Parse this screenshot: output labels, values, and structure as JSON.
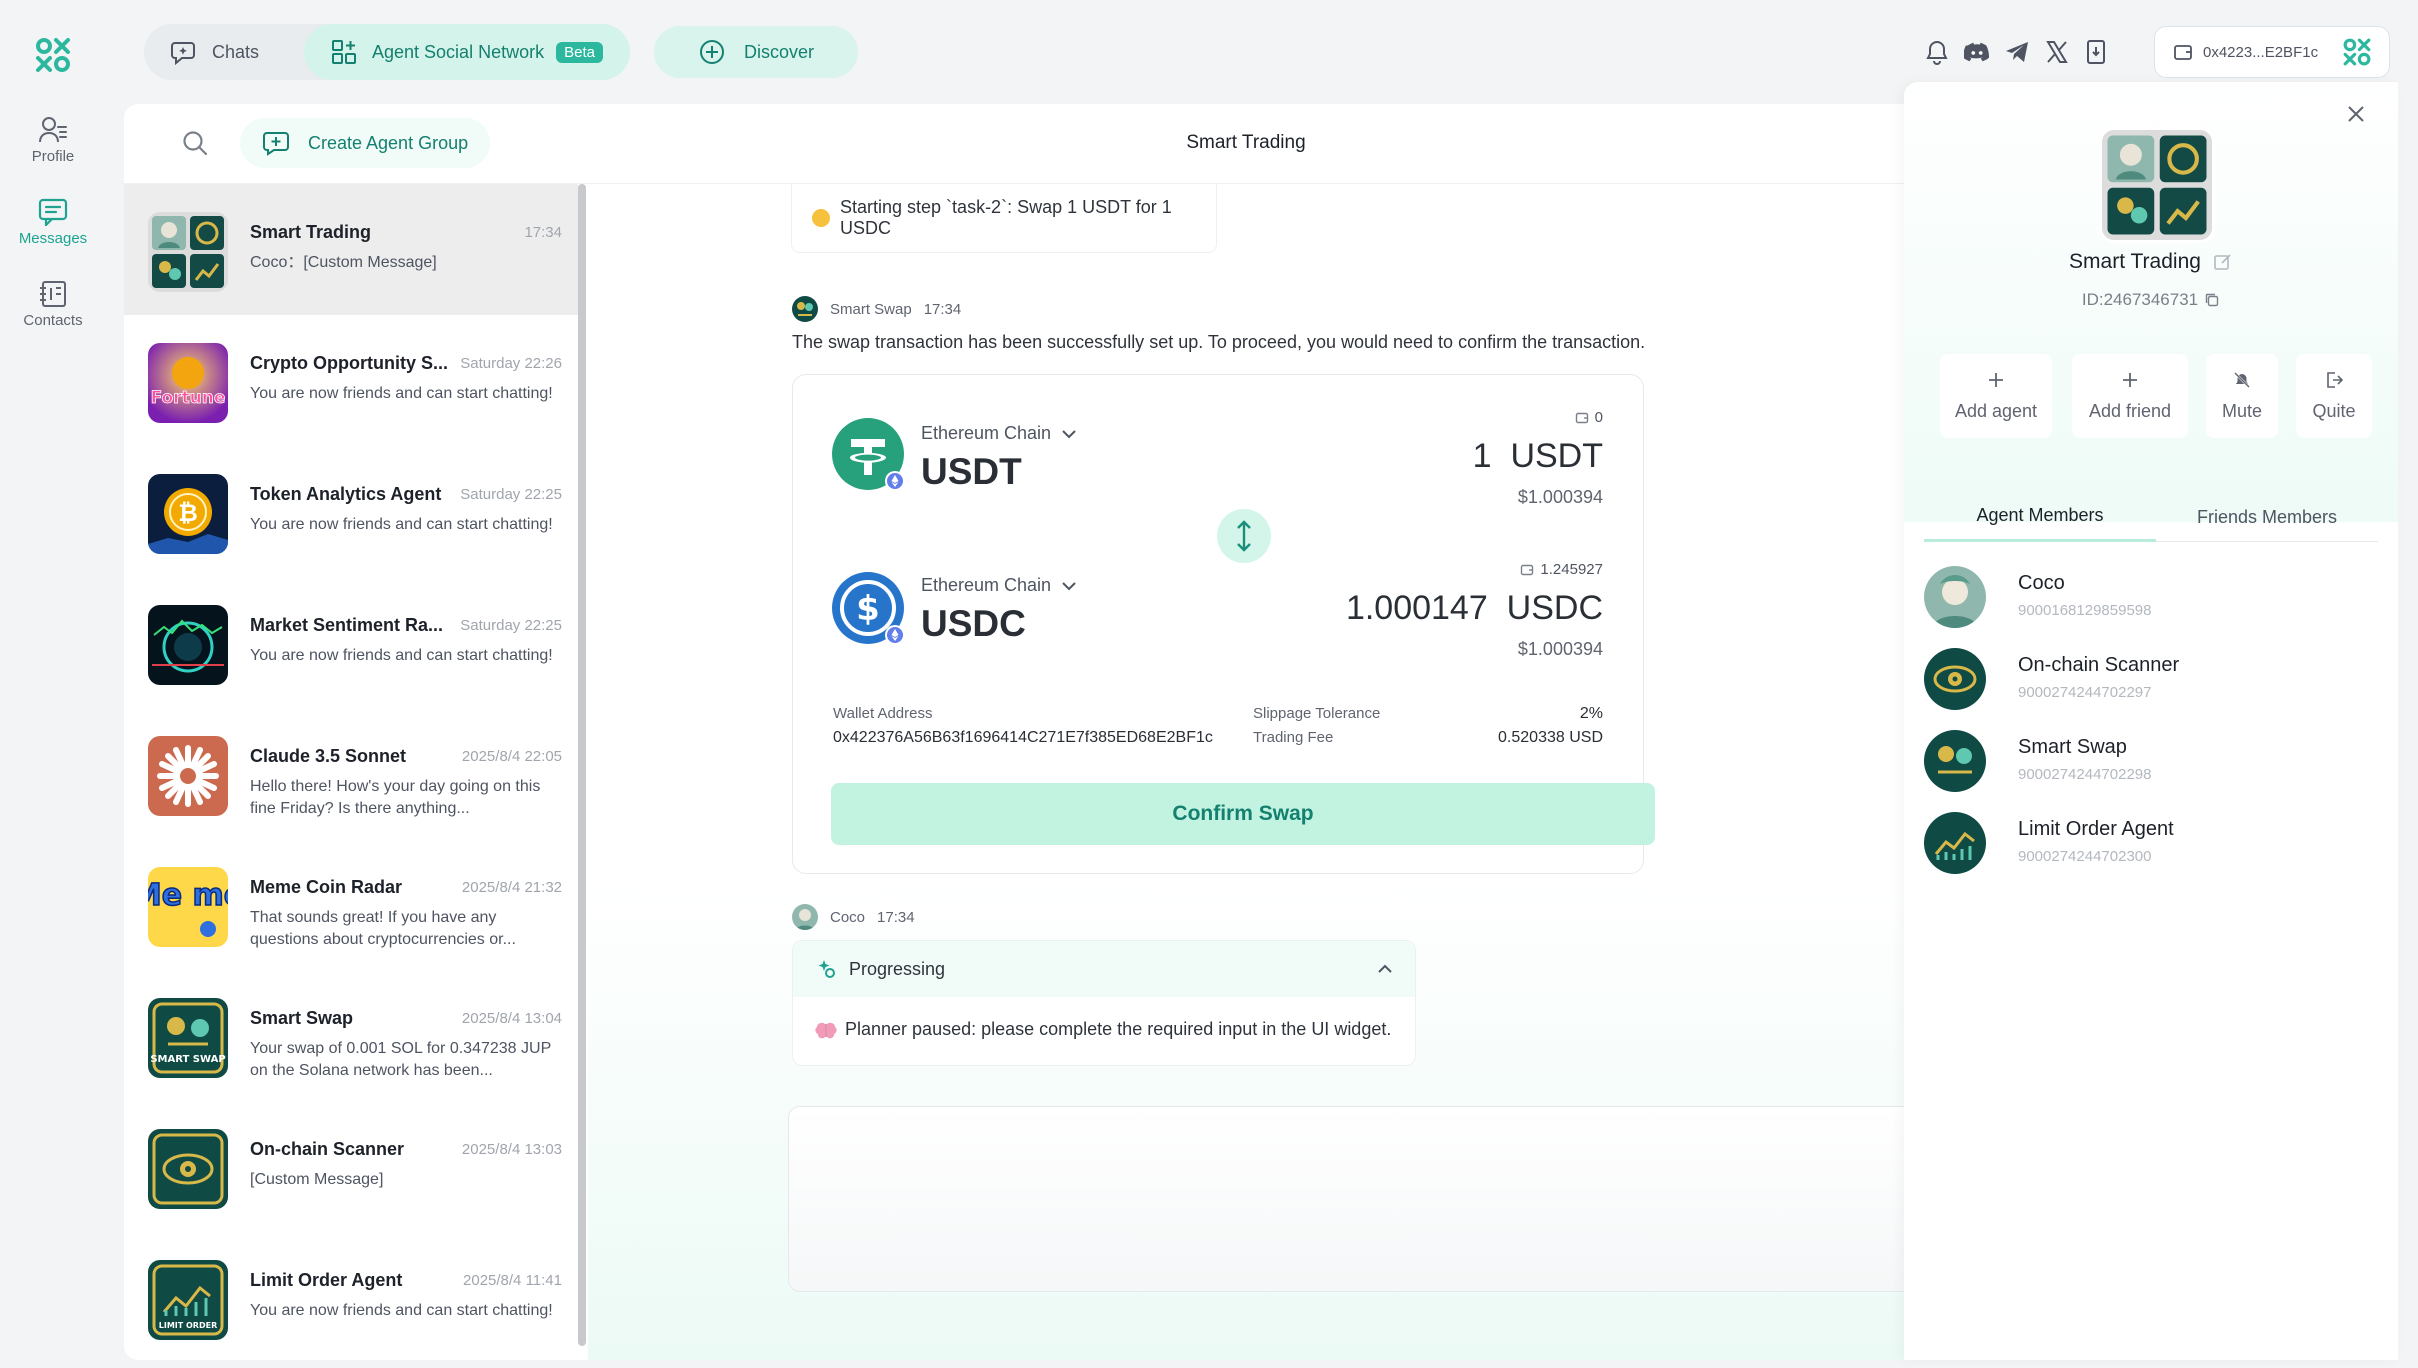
{
  "nav": {
    "items": [
      {
        "id": "profile",
        "label": "Profile"
      },
      {
        "id": "messages",
        "label": "Messages"
      },
      {
        "id": "contacts",
        "label": "Contacts"
      }
    ]
  },
  "topbar": {
    "tabs": [
      {
        "label": "Chats"
      },
      {
        "label": "Agent Social Network",
        "badge": "Beta"
      }
    ],
    "discover_label": "Discover",
    "wallet_short": "0x4223...E2BF1c"
  },
  "chat_list": {
    "create_group_label": "Create Agent Group",
    "chats": [
      {
        "name": "Smart Trading",
        "time": "17:34",
        "preview": "Coco：[Custom Message]"
      },
      {
        "name": "Crypto Opportunity S...",
        "time": "Saturday 22:26",
        "preview": "You are now friends and can start chatting!"
      },
      {
        "name": "Token Analytics Agent",
        "time": "Saturday 22:25",
        "preview": "You are now friends and can start chatting!"
      },
      {
        "name": "Market Sentiment Ra...",
        "time": "Saturday 22:25",
        "preview": "You are now friends and can start chatting!"
      },
      {
        "name": "Claude 3.5 Sonnet",
        "time": "2025/8/4 22:05",
        "preview": "Hello there! How's your day going on this fine Friday? Is there anything..."
      },
      {
        "name": "Meme Coin Radar",
        "time": "2025/8/4 21:32",
        "preview": "That sounds great! If you have any questions about cryptocurrencies or..."
      },
      {
        "name": "Smart Swap",
        "time": "2025/8/4 13:04",
        "preview": "Your swap of 0.001 SOL for 0.347238 JUP on the Solana network has been..."
      },
      {
        "name": "On-chain Scanner",
        "time": "2025/8/4 13:03",
        "preview": "[Custom Message]"
      },
      {
        "name": "Limit Order Agent",
        "time": "2025/8/4 11:41",
        "preview": "You are now friends and can start chatting!"
      }
    ],
    "avatar_labels": {
      "fortune": "Fortune",
      "meme": "Me me",
      "smart_swap": "SMART SWAP",
      "limit_order": "LIMIT ORDER"
    }
  },
  "conversation": {
    "title": "Smart Trading",
    "step_message": "Starting step `task-2`: Swap 1 USDT for 1 USDC",
    "swap_sender": "Smart Swap",
    "swap_time": "17:34",
    "swap_text": "The swap transaction has been successfully set up. To proceed, you would need to confirm the transaction.",
    "swap": {
      "from": {
        "chain": "Ethereum Chain",
        "symbol": "USDT",
        "balance": "0",
        "amount": "1",
        "amount_symbol": "USDT",
        "usd": "$1.000394"
      },
      "to": {
        "chain": "Ethereum Chain",
        "symbol": "USDC",
        "balance": "1.245927",
        "amount": "1.000147",
        "amount_symbol": "USDC",
        "usd": "$1.000394"
      },
      "wallet_label": "Wallet Address",
      "wallet_address": "0x422376A56B63f1696414C271E7f385ED68E2BF1c",
      "slippage_label": "Slippage Tolerance",
      "slippage": "2%",
      "fee_label": "Trading Fee",
      "fee": "0.520338 USD",
      "confirm_label": "Confirm Swap"
    },
    "coco_sender": "Coco",
    "coco_time": "17:34",
    "progress_title": "Progressing",
    "progress_body": "Planner paused: please complete the required input in the UI widget."
  },
  "group_panel": {
    "name": "Smart Trading",
    "id": "ID:2467346731",
    "actions": [
      {
        "label": "Add agent"
      },
      {
        "label": "Add friend"
      },
      {
        "label": "Mute"
      },
      {
        "label": "Quite"
      }
    ],
    "tabs": [
      {
        "label": "Agent Members"
      },
      {
        "label": "Friends Members"
      }
    ],
    "members": [
      {
        "name": "Coco",
        "id": "9000168129859598"
      },
      {
        "name": "On-chain Scanner",
        "id": "9000274244702297"
      },
      {
        "name": "Smart Swap",
        "id": "9000274244702298"
      },
      {
        "name": "Limit Order Agent",
        "id": "9000274244702300"
      }
    ]
  },
  "colors": {
    "accent": "#1fa391",
    "accent_dark": "#14806f",
    "accent_light": "#d4f3ea",
    "usdt": "#26a17b",
    "usdc": "#2775ca",
    "status_dot": "#f6c23e"
  }
}
